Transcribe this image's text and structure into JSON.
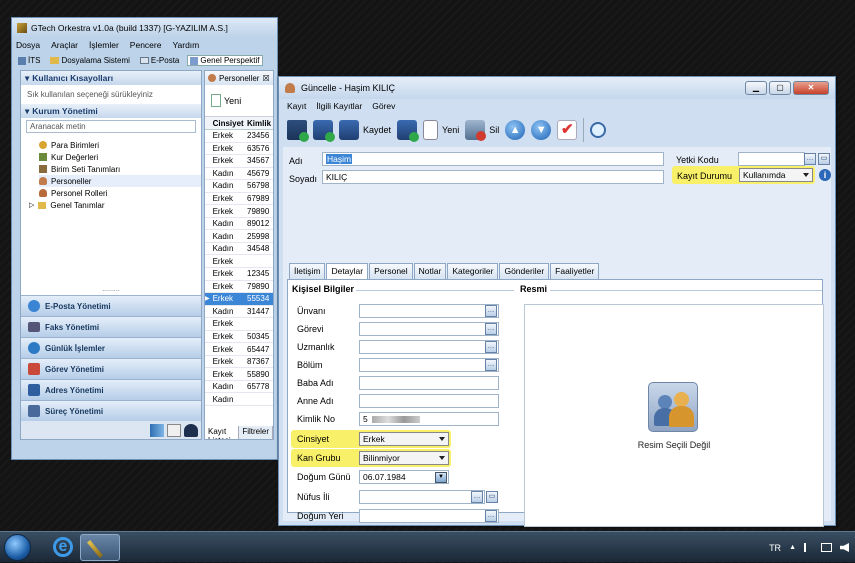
{
  "main_window": {
    "title": "GTech Orkestra v1.0a (build 1337) [G-YAZILIM A.S.]",
    "menu": [
      "Dosya",
      "Araçlar",
      "İşlemler",
      "Pencere",
      "Yardım"
    ],
    "toolbar": [
      "İTS",
      "Dosyalama Sistemi",
      "E-Posta",
      "Genel Perspektif"
    ],
    "left_pane": {
      "shortcuts_header": "Kullanıcı Kısayolları",
      "shortcuts_hint": "Sık kullanılan seçeneği sürükleyiniz",
      "corp_header": "Kurum Yönetimi",
      "search_placeholder": "Aranacak metin",
      "tree": [
        "Para Birimleri",
        "Kur Değerleri",
        "Birim Seti Tanımları",
        "Personeller",
        "Personel Rolleri",
        "Genel Tanımlar"
      ],
      "big_buttons": [
        "E-Posta Yönetimi",
        "Faks Yönetimi",
        "Günlük İşlemler",
        "Görev Yönetimi",
        "Adres Yönetimi",
        "Süreç Yönetimi"
      ]
    },
    "right_pane": {
      "tab": "Personeller",
      "new_button": "Yeni",
      "columns": [
        "Cinsiyet",
        "Kimlik"
      ],
      "rows": [
        [
          "Erkek",
          "23456"
        ],
        [
          "Erkek",
          "63576"
        ],
        [
          "Erkek",
          "34567"
        ],
        [
          "Kadın",
          "45679"
        ],
        [
          "Kadın",
          "56798"
        ],
        [
          "Erkek",
          "67989"
        ],
        [
          "Erkek",
          "79890"
        ],
        [
          "Kadın",
          "89012"
        ],
        [
          "Kadın",
          "25998"
        ],
        [
          "Kadın",
          "34548"
        ],
        [
          "Erkek",
          ""
        ],
        [
          "Erkek",
          "12345"
        ],
        [
          "Erkek",
          "79890"
        ],
        [
          "Erkek",
          "55534"
        ],
        [
          "Kadın",
          "31447"
        ],
        [
          "Erkek",
          ""
        ],
        [
          "Erkek",
          "50345"
        ],
        [
          "Erkek",
          "65447"
        ],
        [
          "Erkek",
          "87367"
        ],
        [
          "Erkek",
          "55890"
        ],
        [
          "Kadın",
          "65778"
        ],
        [
          "Kadın",
          ""
        ]
      ],
      "bottom_tabs": [
        "Kayıt Listesi",
        "Filtreler"
      ]
    }
  },
  "dialog": {
    "title": "Güncelle - Haşim KILIÇ",
    "menu": [
      "Kayıt",
      "İlgili Kayıtlar",
      "Görev"
    ],
    "toolbar": {
      "save": "Kaydet",
      "new": "Yeni",
      "delete": "Sil"
    },
    "fields": {
      "adi_label": "Adı",
      "adi_value": "Haşim",
      "soyadi_label": "Soyadı",
      "soyadi_value": "KILIÇ",
      "yetki_label": "Yetki Kodu",
      "yetki_value": "",
      "durum_label": "Kayıt Durumu",
      "durum_value": "Kullanımda"
    },
    "tabs": [
      "İletişim",
      "Detaylar",
      "Personel",
      "Notlar",
      "Kategoriler",
      "Gönderiler",
      "Faaliyetler"
    ],
    "section_personal": "Kişisel Bilgiler",
    "section_photo": "Resmi",
    "photo_label": "Resim Seçili Değil",
    "personal_fields": [
      {
        "label": "Ünvanı",
        "value": ""
      },
      {
        "label": "Görevi",
        "value": ""
      },
      {
        "label": "Uzmanlık",
        "value": ""
      },
      {
        "label": "Bölüm",
        "value": ""
      },
      {
        "label": "Baba Adı",
        "value": ""
      },
      {
        "label": "Anne Adı",
        "value": ""
      },
      {
        "label": "Kimlik No",
        "value": "5"
      },
      {
        "label": "Cinsiyet",
        "value": "Erkek"
      },
      {
        "label": "Kan Grubu",
        "value": "Bilinmiyor"
      },
      {
        "label": "Doğum Günü",
        "value": "06.07.1984"
      },
      {
        "label": "Nüfus İli",
        "value": ""
      },
      {
        "label": "Doğum Yeri",
        "value": ""
      }
    ]
  },
  "taskbar": {
    "language": "TR"
  }
}
